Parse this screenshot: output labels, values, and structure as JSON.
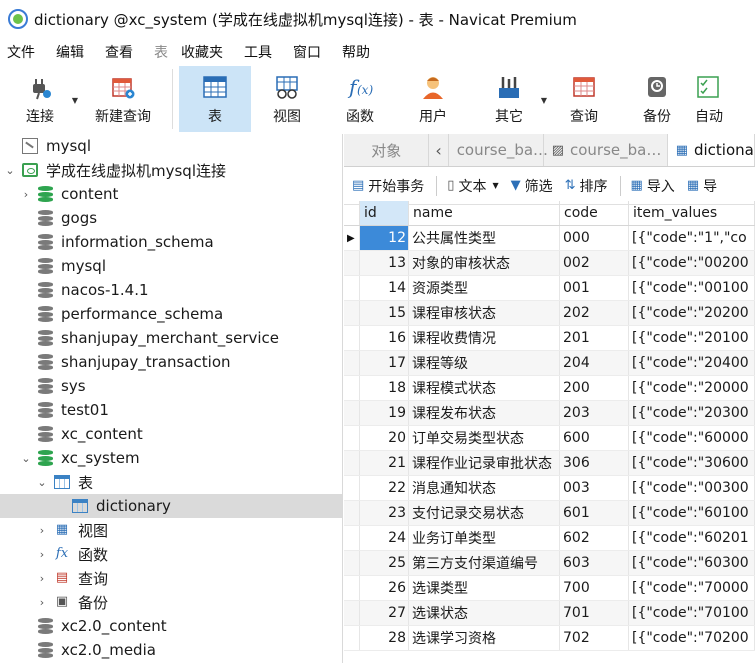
{
  "window": {
    "title": "dictionary @xc_system (学成在线虚拟机mysql连接) - 表 - Navicat Premium"
  },
  "menu": [
    "文件",
    "编辑",
    "查看",
    "收藏夹",
    "工具",
    "窗口",
    "帮助"
  ],
  "menu_prefix": "表",
  "toolbar": [
    {
      "label": "连接",
      "icon": "plug-icon"
    },
    {
      "label": "新建查询",
      "icon": "new-query-icon"
    },
    {
      "label": "表",
      "icon": "table-icon"
    },
    {
      "label": "视图",
      "icon": "view-icon"
    },
    {
      "label": "函数",
      "icon": "function-icon"
    },
    {
      "label": "用户",
      "icon": "user-icon"
    },
    {
      "label": "其它",
      "icon": "tools-icon"
    },
    {
      "label": "查询",
      "icon": "query-icon"
    },
    {
      "label": "备份",
      "icon": "backup-icon"
    },
    {
      "label": "自动",
      "icon": "automation-icon"
    }
  ],
  "tree": {
    "root": "mysql",
    "connection": "学成在线虚拟机mysql连接",
    "databases": [
      "content",
      "gogs",
      "information_schema",
      "mysql",
      "nacos-1.4.1",
      "performance_schema",
      "shanjupay_merchant_service",
      "shanjupay_transaction",
      "sys",
      "test01",
      "xc_content",
      "xc_system"
    ],
    "xc_children": {
      "tables": "表",
      "table": "dictionary",
      "views": "视图",
      "functions": "函数",
      "queries": "查询",
      "backups": "备份"
    },
    "after": [
      "xc2.0_content",
      "xc2.0_media"
    ]
  },
  "tabs": {
    "objects": "对象",
    "tab1": "course_ba…",
    "tab2": "course_ba…",
    "tab3": "dictionary"
  },
  "subtoolbar": {
    "begin_tx": "开始事务",
    "text": "文本",
    "filter": "筛选",
    "sort": "排序",
    "import": "导入",
    "export": "导"
  },
  "columns": [
    "id",
    "name",
    "code",
    "item_values"
  ],
  "rows": [
    {
      "id": "12",
      "name": "公共属性类型",
      "code": "000",
      "item": "[{\"code\":\"1\",\"co"
    },
    {
      "id": "13",
      "name": "对象的审核状态",
      "code": "002",
      "item": "[{\"code\":\"00200"
    },
    {
      "id": "14",
      "name": "资源类型",
      "code": "001",
      "item": "[{\"code\":\"00100"
    },
    {
      "id": "15",
      "name": "课程审核状态",
      "code": "202",
      "item": "[{\"code\":\"20200"
    },
    {
      "id": "16",
      "name": "课程收费情况",
      "code": "201",
      "item": "[{\"code\":\"20100"
    },
    {
      "id": "17",
      "name": "课程等级",
      "code": "204",
      "item": "[{\"code\":\"20400"
    },
    {
      "id": "18",
      "name": "课程模式状态",
      "code": "200",
      "item": "[{\"code\":\"20000"
    },
    {
      "id": "19",
      "name": "课程发布状态",
      "code": "203",
      "item": "[{\"code\":\"20300"
    },
    {
      "id": "20",
      "name": "订单交易类型状态",
      "code": "600",
      "item": "[{\"code\":\"60000"
    },
    {
      "id": "21",
      "name": "课程作业记录审批状态",
      "code": "306",
      "item": "[{\"code\":\"30600"
    },
    {
      "id": "22",
      "name": "消息通知状态",
      "code": "003",
      "item": "[{\"code\":\"00300"
    },
    {
      "id": "23",
      "name": "支付记录交易状态",
      "code": "601",
      "item": "[{\"code\":\"60100"
    },
    {
      "id": "24",
      "name": "业务订单类型",
      "code": "602",
      "item": "[{\"code\":\"60201"
    },
    {
      "id": "25",
      "name": "第三方支付渠道编号",
      "code": "603",
      "item": "[{\"code\":\"60300"
    },
    {
      "id": "26",
      "name": "选课类型",
      "code": "700",
      "item": "[{\"code\":\"70000"
    },
    {
      "id": "27",
      "name": "选课状态",
      "code": "701",
      "item": "[{\"code\":\"70100"
    },
    {
      "id": "28",
      "name": "选课学习资格",
      "code": "702",
      "item": "[{\"code\":\"70200"
    }
  ],
  "selected_row_marker": "▶"
}
